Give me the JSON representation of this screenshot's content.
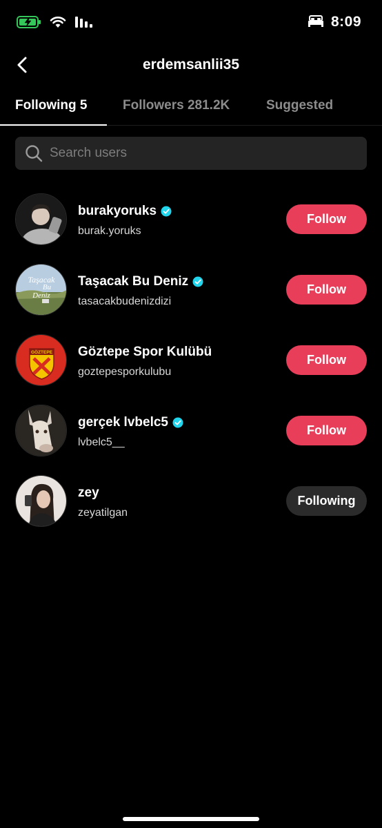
{
  "status_bar": {
    "time": "8:09",
    "battery_icon": "battery-charging-icon",
    "wifi_icon": "wifi-icon",
    "signal_icon": "cellular-signal-icon",
    "bed_icon": "sleep-focus-icon"
  },
  "header": {
    "title": "erdemsanlii35",
    "back_icon": "chevron-left-icon"
  },
  "tabs": [
    {
      "label": "Following 5",
      "active": true
    },
    {
      "label": "Followers 281.2K",
      "active": false
    },
    {
      "label": "Suggested",
      "active": false
    }
  ],
  "search": {
    "placeholder": "Search users",
    "value": ""
  },
  "users": [
    {
      "name": "burakyoruks",
      "handle": "burak.yoruks",
      "verified": true,
      "button": "Follow"
    },
    {
      "name": "Taşacak Bu Deniz",
      "handle": "tasacakbudenizdizi",
      "verified": true,
      "button": "Follow",
      "avatar_text": [
        "Taşacak",
        "Bu",
        "Deniz"
      ]
    },
    {
      "name": "Göztepe Spor Kulübü",
      "handle": "goztepesporkulubu",
      "verified": false,
      "button": "Follow",
      "avatar_text": [
        "GÖZTEPE"
      ]
    },
    {
      "name": "gerçek lvbelc5",
      "handle": "lvbelc5__",
      "verified": true,
      "button": "Follow"
    },
    {
      "name": "zey",
      "handle": "zeyatilgan",
      "verified": false,
      "button": "Following"
    }
  ],
  "colors": {
    "background": "#000000",
    "follow_button": "#e83e5a",
    "following_button": "#2b2b2b",
    "verified_badge": "#20d5ec",
    "search_bg": "#242424"
  }
}
